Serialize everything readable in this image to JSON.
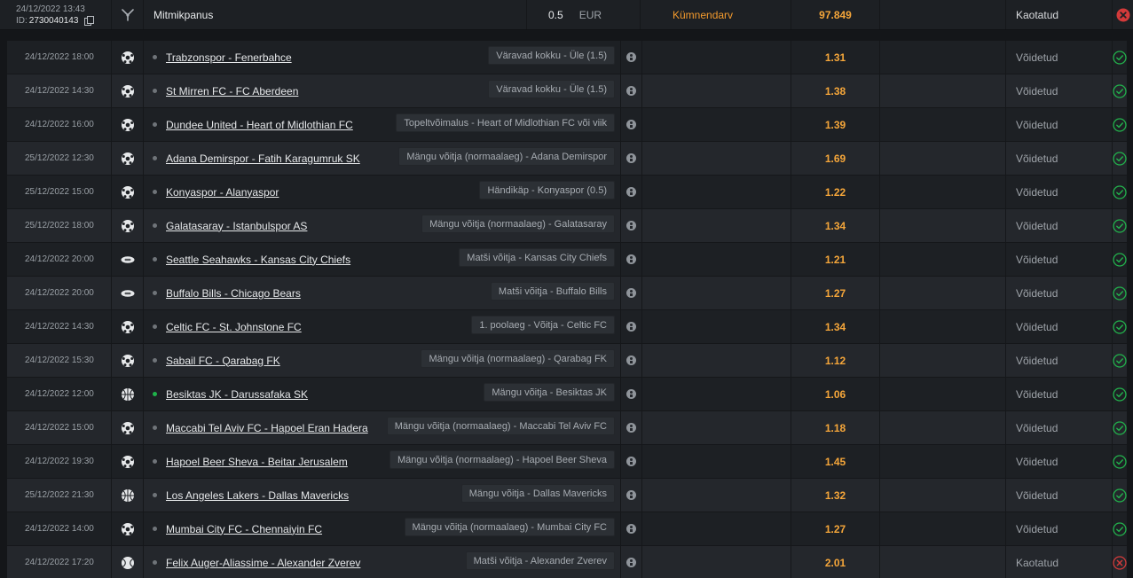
{
  "header": {
    "datetime": "24/12/2022 13:43",
    "id_label": "ID:",
    "id_value": "2730040143",
    "bet_type": "Mitmikpanus",
    "stake": "0.5",
    "currency": "EUR",
    "system_type": "Kümnendarv",
    "total_odds": "97.849",
    "status": "Kaotatud",
    "result_icon": "lost-icon"
  },
  "colors": {
    "accent_odds": "#f5a63a",
    "system_type": "#f39a2d",
    "won": "#22b24c",
    "lost": "#d33a3a"
  },
  "rows": [
    {
      "date": "24/12/2022 18:00",
      "sport": "soccer",
      "live": false,
      "event": "Trabzonspor - Fenerbahce",
      "market": "Väravad kokku - Üle (1.5)",
      "odds": "1.31",
      "status": "Võidetud",
      "result": "won"
    },
    {
      "date": "24/12/2022 14:30",
      "sport": "soccer",
      "live": false,
      "event": "St Mirren FC - FC Aberdeen",
      "market": "Väravad kokku - Üle (1.5)",
      "odds": "1.38",
      "status": "Võidetud",
      "result": "won"
    },
    {
      "date": "24/12/2022 16:00",
      "sport": "soccer",
      "live": false,
      "event": "Dundee United - Heart of Midlothian FC",
      "market": "Topeltvõimalus - Heart of Midlothian FC või viik",
      "odds": "1.39",
      "status": "Võidetud",
      "result": "won"
    },
    {
      "date": "25/12/2022 12:30",
      "sport": "soccer",
      "live": false,
      "event": "Adana Demirspor - Fatih Karagumruk SK",
      "market": "Mängu võitja (normaalaeg) - Adana Demirspor",
      "odds": "1.69",
      "status": "Võidetud",
      "result": "won"
    },
    {
      "date": "25/12/2022 15:00",
      "sport": "soccer",
      "live": false,
      "event": "Konyaspor - Alanyaspor",
      "market": "Händikäp - Konyaspor (0.5)",
      "odds": "1.22",
      "status": "Võidetud",
      "result": "won"
    },
    {
      "date": "25/12/2022 18:00",
      "sport": "soccer",
      "live": false,
      "event": "Galatasaray - Istanbulspor AS",
      "market": "Mängu võitja (normaalaeg) - Galatasaray",
      "odds": "1.34",
      "status": "Võidetud",
      "result": "won"
    },
    {
      "date": "24/12/2022 20:00",
      "sport": "football",
      "live": false,
      "event": "Seattle Seahawks - Kansas City Chiefs",
      "market": "Matši võitja - Kansas City Chiefs",
      "odds": "1.21",
      "status": "Võidetud",
      "result": "won"
    },
    {
      "date": "24/12/2022 20:00",
      "sport": "football",
      "live": false,
      "event": "Buffalo Bills - Chicago Bears",
      "market": "Matši võitja - Buffalo Bills",
      "odds": "1.27",
      "status": "Võidetud",
      "result": "won"
    },
    {
      "date": "24/12/2022 14:30",
      "sport": "soccer",
      "live": false,
      "event": "Celtic FC - St. Johnstone FC",
      "market": "1. poolaeg - Võitja - Celtic FC",
      "odds": "1.34",
      "status": "Võidetud",
      "result": "won"
    },
    {
      "date": "24/12/2022 15:30",
      "sport": "soccer",
      "live": false,
      "event": "Sabail FC - Qarabag FK",
      "market": "Mängu võitja (normaalaeg) - Qarabag FK",
      "odds": "1.12",
      "status": "Võidetud",
      "result": "won"
    },
    {
      "date": "24/12/2022 12:00",
      "sport": "basketball",
      "live": true,
      "event": "Besiktas JK - Darussafaka SK",
      "market": "Mängu võitja - Besiktas JK",
      "odds": "1.06",
      "status": "Võidetud",
      "result": "won"
    },
    {
      "date": "24/12/2022 15:00",
      "sport": "soccer",
      "live": false,
      "event": "Maccabi Tel Aviv FC - Hapoel Eran Hadera",
      "market": "Mängu võitja (normaalaeg) - Maccabi Tel Aviv FC",
      "odds": "1.18",
      "status": "Võidetud",
      "result": "won"
    },
    {
      "date": "24/12/2022 19:30",
      "sport": "soccer",
      "live": false,
      "event": "Hapoel Beer Sheva - Beitar Jerusalem",
      "market": "Mängu võitja (normaalaeg) - Hapoel Beer Sheva",
      "odds": "1.45",
      "status": "Võidetud",
      "result": "won"
    },
    {
      "date": "25/12/2022 21:30",
      "sport": "basketball",
      "live": false,
      "event": "Los Angeles Lakers - Dallas Mavericks",
      "market": "Mängu võitja - Dallas Mavericks",
      "odds": "1.32",
      "status": "Võidetud",
      "result": "won"
    },
    {
      "date": "24/12/2022 14:00",
      "sport": "soccer",
      "live": false,
      "event": "Mumbai City FC - Chennaiyin FC",
      "market": "Mängu võitja (normaalaeg) - Mumbai City FC",
      "odds": "1.27",
      "status": "Võidetud",
      "result": "won"
    },
    {
      "date": "24/12/2022 17:20",
      "sport": "tennis",
      "live": false,
      "event": "Felix Auger-Aliassime - Alexander Zverev",
      "market": "Matši võitja - Alexander Zverev",
      "odds": "2.01",
      "status": "Kaotatud",
      "result": "lost"
    }
  ]
}
